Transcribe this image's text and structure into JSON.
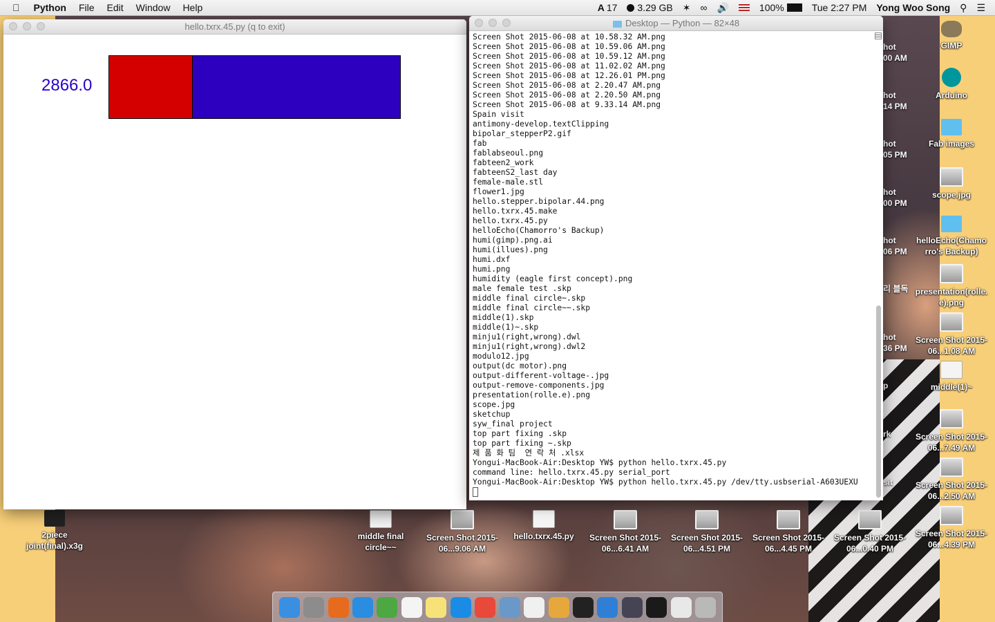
{
  "menubar": {
    "app_name": "Python",
    "menus": [
      "File",
      "Edit",
      "Window",
      "Help"
    ],
    "status": {
      "adobe_count": "17",
      "memory": "3.29 GB",
      "battery": "100%",
      "datetime": "Tue 2:27 PM",
      "user": "Yong Woo Song"
    }
  },
  "python_window": {
    "title": "hello.txrx.45.py (q to exit)",
    "value_text": "2866.0",
    "bar_fill_fraction": 0.285,
    "colors": {
      "value": "#2a00c8",
      "fill": "#d40000",
      "background": "#2d00c0"
    }
  },
  "terminal": {
    "title": "Desktop — Python — 82×48",
    "lines": [
      "Screen Shot 2015-06-08 at 10.58.32 AM.png",
      "Screen Shot 2015-06-08 at 10.59.06 AM.png",
      "Screen Shot 2015-06-08 at 10.59.12 AM.png",
      "Screen Shot 2015-06-08 at 11.02.02 AM.png",
      "Screen Shot 2015-06-08 at 12.26.01 PM.png",
      "Screen Shot 2015-06-08 at 2.20.47 AM.png",
      "Screen Shot 2015-06-08 at 2.20.50 AM.png",
      "Screen Shot 2015-06-08 at 9.33.14 AM.png",
      "Spain visit",
      "antimony-develop.textClipping",
      "bipolar_stepperP2.gif",
      "fab",
      "fablabseoul.png",
      "fabteen2_work",
      "fabteenS2_last day",
      "female-male.stl",
      "flower1.jpg",
      "hello.stepper.bipolar.44.png",
      "hello.txrx.45.make",
      "hello.txrx.45.py",
      "helloEcho(Chamorro's Backup)",
      "humi(gimp).png.ai",
      "humi(illues).png",
      "humi.dxf",
      "humi.png",
      "humidity (eagle first concept).png",
      "male female test .skp",
      "middle final circle~.skp",
      "middle final circle~~.skp",
      "middle(1).skp",
      "middle(1)~.skp",
      "minju1(right,wrong).dwl",
      "minju1(right,wrong).dwl2",
      "modulo12.jpg",
      "output(dc motor).png",
      "output-different-voltage-.jpg",
      "output-remove-components.jpg",
      "presentation(rolle.e).png",
      "scope.jpg",
      "sketchup",
      "syw_final project",
      "top part fixing .skp",
      "top part fixing ~.skp",
      "제 품 화 팀  연 락 처 .xlsx",
      "Yongui-MacBook-Air:Desktop YW$ python hello.txrx.45.py",
      "command line: hello.txrx.45.py serial_port",
      "Yongui-MacBook-Air:Desktop YW$ python hello.txrx.45.py /dev/tty.usbserial-A603UEXU"
    ]
  },
  "desktop_icons_right": [
    {
      "label": "GIMP"
    },
    {
      "label": "Arduino"
    },
    {
      "label": "Fab images"
    },
    {
      "label": "scope.jpg"
    },
    {
      "label": "helloEcho(Chamo rro's Backup)"
    },
    {
      "label": "presentation(rolle. e).png"
    },
    {
      "label": "Screen Shot 2015-06...1.08 AM"
    },
    {
      "label": "middle(1)~"
    },
    {
      "label": "Screen Shot 2015-06...7.49 AM"
    },
    {
      "label": "Screen Shot 2015-06...2.50 AM"
    },
    {
      "label": "Screen Shot 2015-06...4.39 PM"
    }
  ],
  "desktop_icons_bottom": [
    {
      "label": "2piece joint(final).x3g"
    },
    {
      "label": "middle final circle~~"
    },
    {
      "label": "Screen Shot 2015-06...9.06 AM"
    },
    {
      "label": "hello.txrx.45.py"
    },
    {
      "label": "Screen Shot 2015-06...6.41 AM"
    },
    {
      "label": "Screen Shot 2015-06...4.51 PM"
    },
    {
      "label": "Screen Shot 2015-06...4.45 PM"
    },
    {
      "label": "Screen Shot 2015-06...0.40 PM"
    }
  ],
  "partially_hidden_labels": [
    "hot\n00 AM",
    "hot\n14 PM",
    "hot\n05 PM",
    "hot\n00 PM",
    "hot\n06 PM",
    "리 블독",
    "hot\n36 PM",
    "p",
    "rk",
    "sit"
  ],
  "dock": [
    "finder-icon",
    "launchpad-icon",
    "firefox-icon",
    "safari-icon",
    "evernote-icon",
    "calendar-icon",
    "notes-icon",
    "app-store-icon",
    "chrome-icon",
    "preview-icon",
    "textedit-icon",
    "photos-icon",
    "terminal-icon",
    "finder-folder-icon",
    "rocket-icon",
    "p-app-icon",
    "mail-icon",
    "trash-icon"
  ]
}
